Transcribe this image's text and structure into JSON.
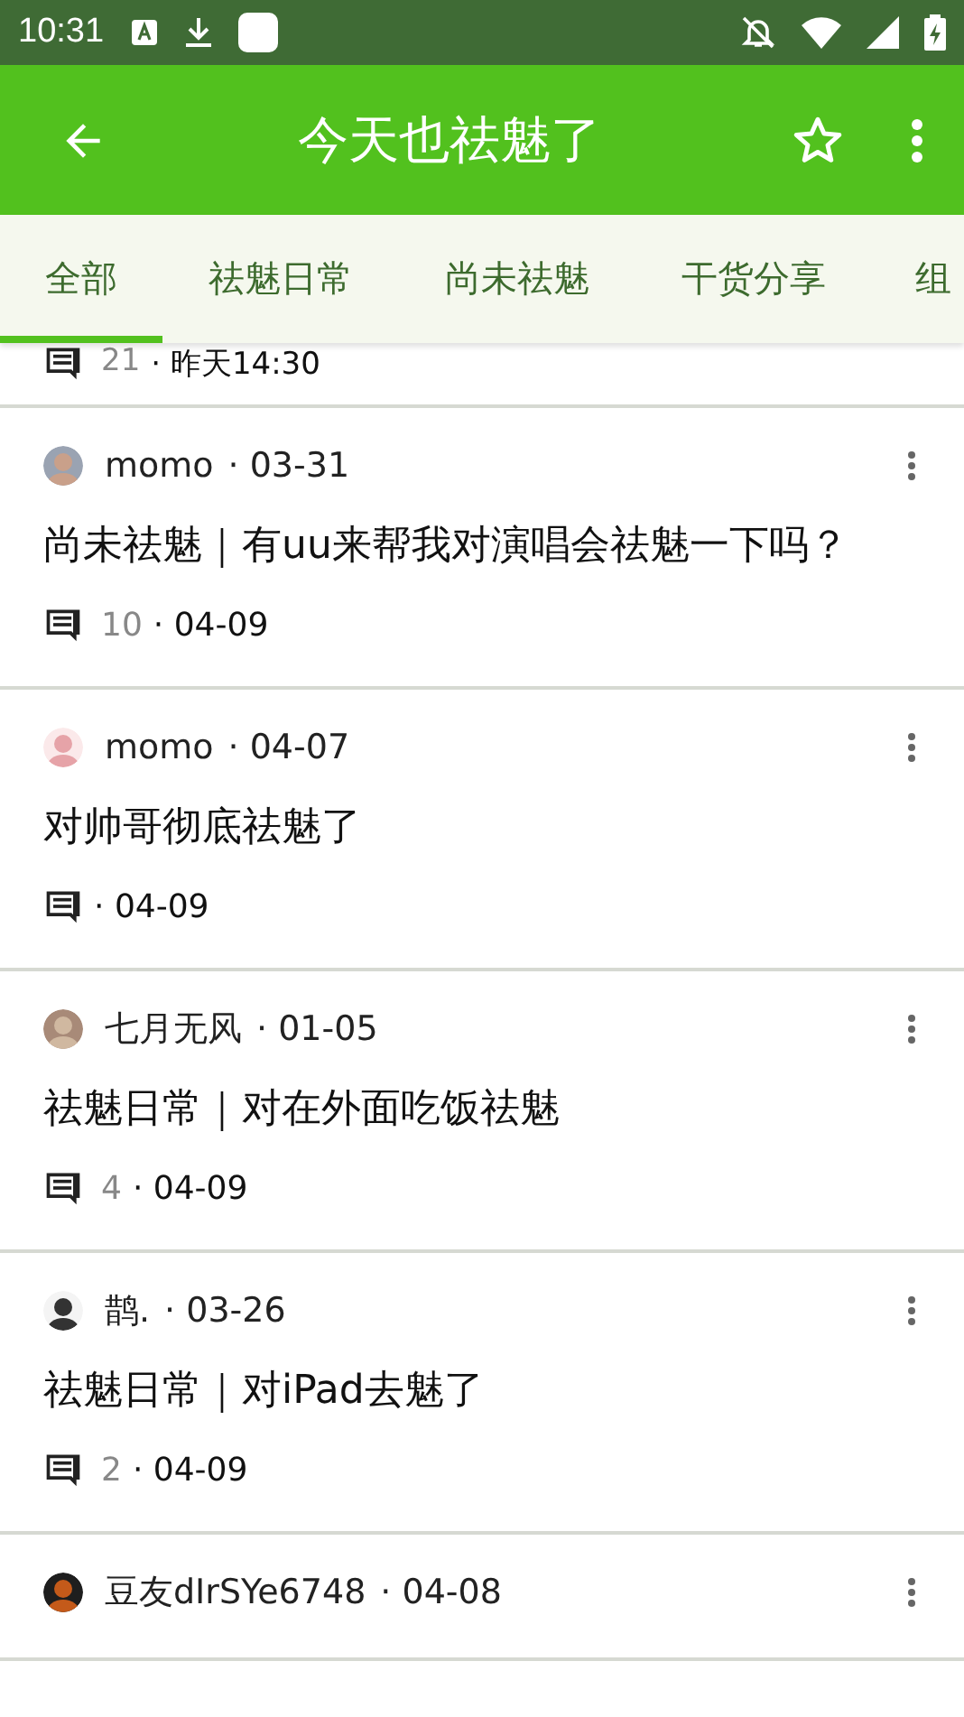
{
  "status_bar": {
    "time": "10:31"
  },
  "toolbar": {
    "title": "今天也祛魅了"
  },
  "tabs": [
    {
      "label": "全部",
      "selected": true
    },
    {
      "label": "祛魅日常",
      "selected": false
    },
    {
      "label": "尚未祛魅",
      "selected": false
    },
    {
      "label": "干货分享",
      "selected": false
    },
    {
      "label": "组",
      "selected": false
    }
  ],
  "partial_post": {
    "comments": "21",
    "date": "· 昨天14:30"
  },
  "posts": [
    {
      "author": "momo",
      "date": "· 03-31",
      "title": "尚未祛魅｜有uu来帮我对演唱会祛魅一下吗？",
      "comments": "10",
      "reply_date": "· 04-09"
    },
    {
      "author": "momo",
      "date": "· 04-07",
      "title": "对帅哥彻底祛魅了",
      "reply_date": "· 04-09"
    },
    {
      "author": "七月无风",
      "date": "· 01-05",
      "title": "祛魅日常｜对在外面吃饭祛魅",
      "comments": "4",
      "reply_date": "· 04-09"
    },
    {
      "author": "鹊.",
      "date": "· 03-26",
      "title": "祛魅日常｜对iPad去魅了",
      "comments": "2",
      "reply_date": "· 04-09"
    },
    {
      "author": "豆友dIrSYe6748",
      "date": "· 04-08"
    }
  ]
}
